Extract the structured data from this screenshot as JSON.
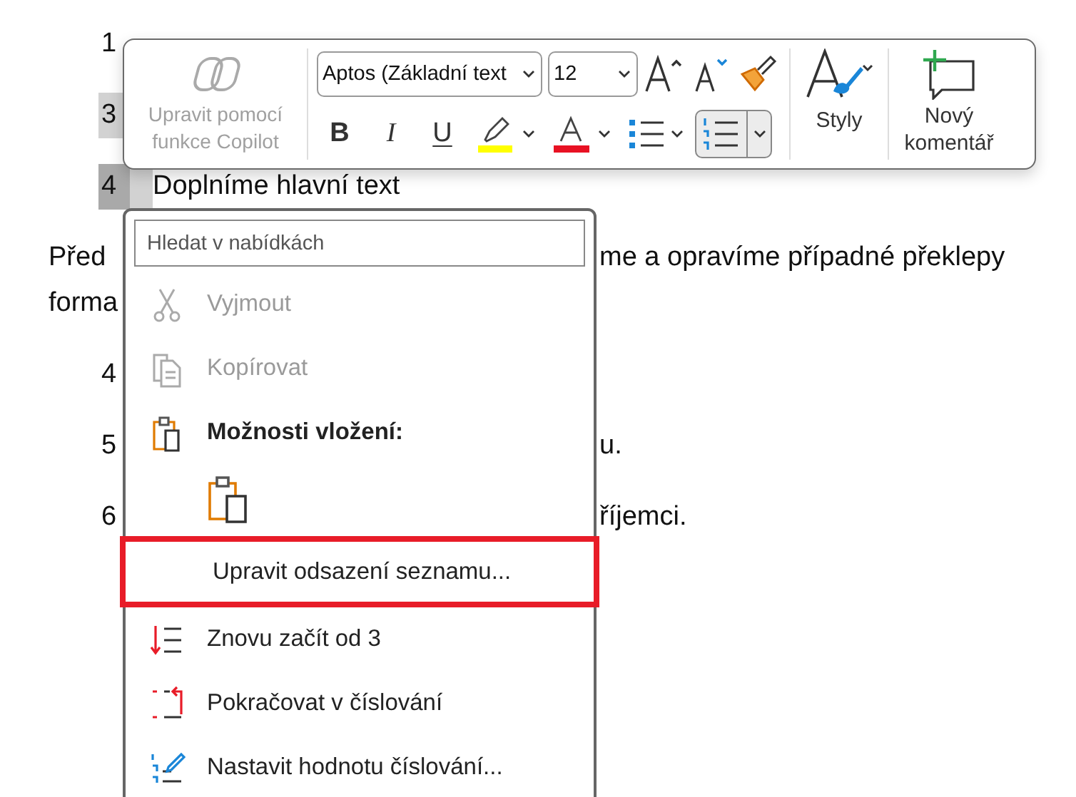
{
  "document": {
    "rows": [
      {
        "kind": "list",
        "number": "1",
        "highlighted": false,
        "selected": false
      },
      {
        "kind": "list",
        "number": "3",
        "highlighted": true,
        "selected": false
      },
      {
        "kind": "list",
        "number": "4",
        "highlighted": true,
        "selected": true,
        "text": "Doplníme hlavní text"
      },
      {
        "kind": "para",
        "text": "Před",
        "right_text": "me a opravíme případné překlepy"
      },
      {
        "kind": "wrap",
        "text": "forma"
      },
      {
        "kind": "list",
        "number": "4",
        "highlighted": false,
        "selected": false
      },
      {
        "kind": "list",
        "number": "5",
        "highlighted": false,
        "selected": false,
        "right_text": "u."
      },
      {
        "kind": "list",
        "number": "6",
        "highlighted": false,
        "selected": false,
        "right_text": "říjemci."
      }
    ]
  },
  "toolbar": {
    "copilot": {
      "label": "Upravit pomocí funkce Copilot",
      "disabled": true
    },
    "font": {
      "value": "Aptos (Základní text"
    },
    "size": {
      "value": "12"
    },
    "format_buttons": [
      {
        "kind": "bold",
        "label": "B"
      },
      {
        "kind": "italic",
        "label": "I"
      },
      {
        "kind": "underline",
        "label": "U"
      }
    ],
    "highlight": {
      "color": "#ffff00"
    },
    "font_color": {
      "color": "#e81123"
    },
    "bullets": {
      "selected": false
    },
    "numbering": {
      "selected": true
    },
    "styles": {
      "label": "Styly"
    },
    "comment": {
      "label": "Nový komentář"
    }
  },
  "menu": {
    "search": {
      "placeholder": "Hledat v nabídkách"
    },
    "items": [
      {
        "kind": "cut",
        "label": "Vyjmout",
        "disabled": true,
        "outlined": false
      },
      {
        "kind": "copy",
        "label": "Kopírovat",
        "disabled": true,
        "outlined": false
      },
      {
        "kind": "header",
        "label": "Možnosti vložení:",
        "disabled": false,
        "outlined": false
      },
      {
        "kind": "paste_option"
      },
      {
        "kind": "plain",
        "label": "Upravit odsazení seznamu...",
        "disabled": false,
        "outlined": true
      },
      {
        "kind": "restart",
        "label": "Znovu začít od 3",
        "disabled": false,
        "outlined": false
      },
      {
        "kind": "continue",
        "label": "Pokračovat v číslování",
        "disabled": false,
        "outlined": false
      },
      {
        "kind": "set_value",
        "label": "Nastavit hodnotu číslování...",
        "disabled": false,
        "outlined": false
      }
    ]
  }
}
